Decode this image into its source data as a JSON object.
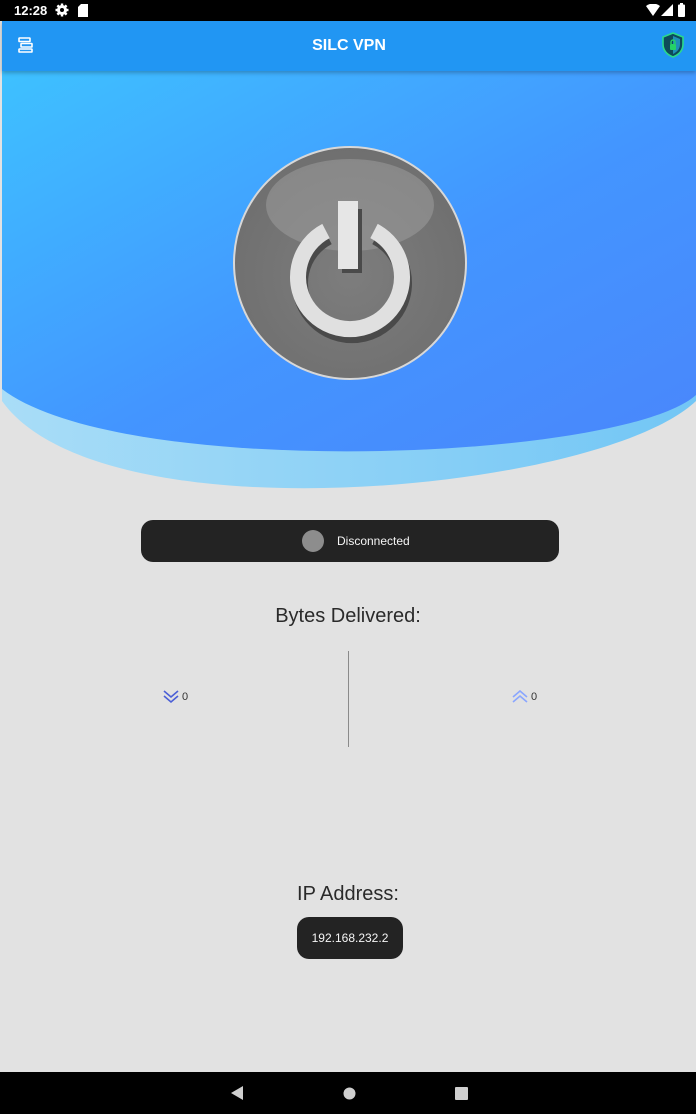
{
  "status_bar": {
    "time": "12:28"
  },
  "app_bar": {
    "title": "SILC VPN"
  },
  "connection": {
    "status": "Disconnected"
  },
  "bytes": {
    "heading": "Bytes Delivered:",
    "download": "0",
    "upload": "0"
  },
  "ip": {
    "heading": "IP Address:",
    "address": "192.168.232.2"
  },
  "colors": {
    "app_bar": "#2196f3",
    "pill": "#232323",
    "background": "#e2e2e2"
  },
  "icons": [
    "gear-icon",
    "sd-card-icon",
    "wifi-icon",
    "signal-icon",
    "battery-icon",
    "menu-icon",
    "shield-lock-icon",
    "power-icon",
    "download-arrows-icon",
    "upload-arrows-icon",
    "back-icon",
    "home-icon",
    "recents-icon"
  ]
}
